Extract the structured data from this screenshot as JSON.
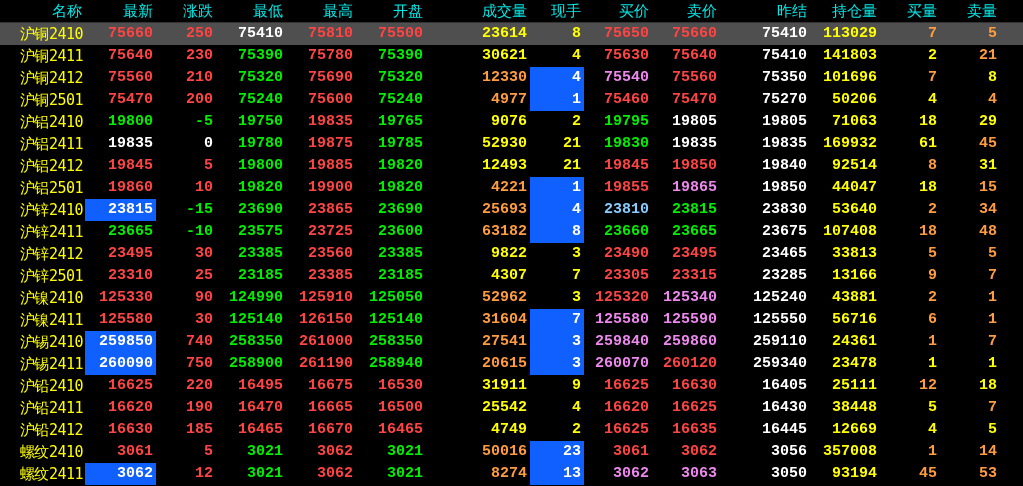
{
  "columns": [
    "名称",
    "最新",
    "涨跌",
    "最低",
    "最高",
    "开盘",
    "成交量",
    "现手",
    "买价",
    "卖价",
    "昨结",
    "持仓量",
    "买量",
    "卖量"
  ],
  "rows": [
    {
      "name": "沪铜2410",
      "selected": true,
      "cells": [
        {
          "text": "75660",
          "color": "#ff4444",
          "flash": false
        },
        {
          "text": "250",
          "color": "#ff4444",
          "flash": false
        },
        {
          "text": "75410",
          "color": "#ffffff",
          "flash": false
        },
        {
          "text": "75810",
          "color": "#ff4444",
          "flash": false
        },
        {
          "text": "75500",
          "color": "#ff4444",
          "flash": false
        },
        {
          "text": "23614",
          "color": "#ffff00",
          "flash": false
        },
        {
          "text": "8",
          "color": "#ffff00",
          "flash": false
        },
        {
          "text": "75650",
          "color": "#ff4444",
          "flash": false
        },
        {
          "text": "75660",
          "color": "#ff4444",
          "flash": false
        },
        {
          "text": "75410",
          "color": "#ffffff",
          "flash": false
        },
        {
          "text": "113029",
          "color": "#ffff00",
          "flash": false
        },
        {
          "text": "7",
          "color": "#ff9c40",
          "flash": false
        },
        {
          "text": "5",
          "color": "#ff9c40",
          "flash": false
        }
      ]
    },
    {
      "name": "沪铜2411",
      "selected": false,
      "cells": [
        {
          "text": "75640",
          "color": "#ff4444",
          "flash": false
        },
        {
          "text": "230",
          "color": "#ff4444",
          "flash": false
        },
        {
          "text": "75390",
          "color": "#00ee00",
          "flash": false
        },
        {
          "text": "75780",
          "color": "#ff4444",
          "flash": false
        },
        {
          "text": "75390",
          "color": "#00ee00",
          "flash": false
        },
        {
          "text": "30621",
          "color": "#ffff00",
          "flash": false
        },
        {
          "text": "4",
          "color": "#ffff00",
          "flash": false
        },
        {
          "text": "75630",
          "color": "#ff4444",
          "flash": false
        },
        {
          "text": "75640",
          "color": "#ff4444",
          "flash": false
        },
        {
          "text": "75410",
          "color": "#ffffff",
          "flash": false
        },
        {
          "text": "141803",
          "color": "#ffff00",
          "flash": false
        },
        {
          "text": "2",
          "color": "#ffff00",
          "flash": false
        },
        {
          "text": "21",
          "color": "#ff9c40",
          "flash": false
        }
      ]
    },
    {
      "name": "沪铜2412",
      "selected": false,
      "cells": [
        {
          "text": "75560",
          "color": "#ff4444",
          "flash": false
        },
        {
          "text": "210",
          "color": "#ff4444",
          "flash": false
        },
        {
          "text": "75320",
          "color": "#00ee00",
          "flash": false
        },
        {
          "text": "75690",
          "color": "#ff4444",
          "flash": false
        },
        {
          "text": "75320",
          "color": "#00ee00",
          "flash": false
        },
        {
          "text": "12330",
          "color": "#ff9c40",
          "flash": false
        },
        {
          "text": "4",
          "color": "#ffffff",
          "flash": true
        },
        {
          "text": "75540",
          "color": "#ee88ee",
          "flash": false
        },
        {
          "text": "75560",
          "color": "#ff4444",
          "flash": false
        },
        {
          "text": "75350",
          "color": "#ffffff",
          "flash": false
        },
        {
          "text": "101696",
          "color": "#ffff00",
          "flash": false
        },
        {
          "text": "7",
          "color": "#ff9c40",
          "flash": false
        },
        {
          "text": "8",
          "color": "#ffff00",
          "flash": false
        }
      ]
    },
    {
      "name": "沪铜2501",
      "selected": false,
      "cells": [
        {
          "text": "75470",
          "color": "#ff4444",
          "flash": false
        },
        {
          "text": "200",
          "color": "#ff4444",
          "flash": false
        },
        {
          "text": "75240",
          "color": "#00ee00",
          "flash": false
        },
        {
          "text": "75600",
          "color": "#ff4444",
          "flash": false
        },
        {
          "text": "75240",
          "color": "#00ee00",
          "flash": false
        },
        {
          "text": "4977",
          "color": "#ff9c40",
          "flash": false
        },
        {
          "text": "1",
          "color": "#ffffff",
          "flash": true
        },
        {
          "text": "75460",
          "color": "#ff4444",
          "flash": false
        },
        {
          "text": "75470",
          "color": "#ff4444",
          "flash": false
        },
        {
          "text": "75270",
          "color": "#ffffff",
          "flash": false
        },
        {
          "text": "50206",
          "color": "#ffff00",
          "flash": false
        },
        {
          "text": "4",
          "color": "#ffff00",
          "flash": false
        },
        {
          "text": "4",
          "color": "#ff9c40",
          "flash": false
        }
      ]
    },
    {
      "name": "沪铝2410",
      "selected": false,
      "cells": [
        {
          "text": "19800",
          "color": "#00ee00",
          "flash": false
        },
        {
          "text": "-5",
          "color": "#00ee00",
          "flash": false
        },
        {
          "text": "19750",
          "color": "#00ee00",
          "flash": false
        },
        {
          "text": "19835",
          "color": "#ff4444",
          "flash": false
        },
        {
          "text": "19765",
          "color": "#00ee00",
          "flash": false
        },
        {
          "text": "9076",
          "color": "#ffff00",
          "flash": false
        },
        {
          "text": "2",
          "color": "#ffff00",
          "flash": false
        },
        {
          "text": "19795",
          "color": "#00ee00",
          "flash": false
        },
        {
          "text": "19805",
          "color": "#ffffff",
          "flash": false
        },
        {
          "text": "19805",
          "color": "#ffffff",
          "flash": false
        },
        {
          "text": "71063",
          "color": "#ffff00",
          "flash": false
        },
        {
          "text": "18",
          "color": "#ffff00",
          "flash": false
        },
        {
          "text": "29",
          "color": "#ffff00",
          "flash": false
        }
      ]
    },
    {
      "name": "沪铝2411",
      "selected": false,
      "cells": [
        {
          "text": "19835",
          "color": "#ffffff",
          "flash": false
        },
        {
          "text": "0",
          "color": "#ffffff",
          "flash": false
        },
        {
          "text": "19780",
          "color": "#00ee00",
          "flash": false
        },
        {
          "text": "19875",
          "color": "#ff4444",
          "flash": false
        },
        {
          "text": "19785",
          "color": "#00ee00",
          "flash": false
        },
        {
          "text": "52930",
          "color": "#ffff00",
          "flash": false
        },
        {
          "text": "21",
          "color": "#ffff00",
          "flash": false
        },
        {
          "text": "19830",
          "color": "#00ee00",
          "flash": false
        },
        {
          "text": "19835",
          "color": "#ffffff",
          "flash": false
        },
        {
          "text": "19835",
          "color": "#ffffff",
          "flash": false
        },
        {
          "text": "169932",
          "color": "#ffff00",
          "flash": false
        },
        {
          "text": "61",
          "color": "#ffff00",
          "flash": false
        },
        {
          "text": "45",
          "color": "#ff9c40",
          "flash": false
        }
      ]
    },
    {
      "name": "沪铝2412",
      "selected": false,
      "cells": [
        {
          "text": "19845",
          "color": "#ff4444",
          "flash": false
        },
        {
          "text": "5",
          "color": "#ff4444",
          "flash": false
        },
        {
          "text": "19800",
          "color": "#00ee00",
          "flash": false
        },
        {
          "text": "19885",
          "color": "#ff4444",
          "flash": false
        },
        {
          "text": "19820",
          "color": "#00ee00",
          "flash": false
        },
        {
          "text": "12493",
          "color": "#ffff00",
          "flash": false
        },
        {
          "text": "21",
          "color": "#ffff00",
          "flash": false
        },
        {
          "text": "19845",
          "color": "#ff4444",
          "flash": false
        },
        {
          "text": "19850",
          "color": "#ff4444",
          "flash": false
        },
        {
          "text": "19840",
          "color": "#ffffff",
          "flash": false
        },
        {
          "text": "92514",
          "color": "#ffff00",
          "flash": false
        },
        {
          "text": "8",
          "color": "#ff9c40",
          "flash": false
        },
        {
          "text": "31",
          "color": "#ffff00",
          "flash": false
        }
      ]
    },
    {
      "name": "沪铝2501",
      "selected": false,
      "cells": [
        {
          "text": "19860",
          "color": "#ff4444",
          "flash": false
        },
        {
          "text": "10",
          "color": "#ff4444",
          "flash": false
        },
        {
          "text": "19820",
          "color": "#00ee00",
          "flash": false
        },
        {
          "text": "19900",
          "color": "#ff4444",
          "flash": false
        },
        {
          "text": "19820",
          "color": "#00ee00",
          "flash": false
        },
        {
          "text": "4221",
          "color": "#ff9c40",
          "flash": false
        },
        {
          "text": "1",
          "color": "#ffffff",
          "flash": true
        },
        {
          "text": "19855",
          "color": "#ff4444",
          "flash": false
        },
        {
          "text": "19865",
          "color": "#ee88ee",
          "flash": false
        },
        {
          "text": "19850",
          "color": "#ffffff",
          "flash": false
        },
        {
          "text": "44047",
          "color": "#ffff00",
          "flash": false
        },
        {
          "text": "18",
          "color": "#ffff00",
          "flash": false
        },
        {
          "text": "15",
          "color": "#ff9c40",
          "flash": false
        }
      ]
    },
    {
      "name": "沪锌2410",
      "selected": false,
      "cells": [
        {
          "text": "23815",
          "color": "#ffffff",
          "flash": true
        },
        {
          "text": "-15",
          "color": "#00ee00",
          "flash": false
        },
        {
          "text": "23690",
          "color": "#00ee00",
          "flash": false
        },
        {
          "text": "23865",
          "color": "#ff4444",
          "flash": false
        },
        {
          "text": "23690",
          "color": "#00ee00",
          "flash": false
        },
        {
          "text": "25693",
          "color": "#ff9c40",
          "flash": false
        },
        {
          "text": "4",
          "color": "#ffffff",
          "flash": true
        },
        {
          "text": "23810",
          "color": "#88ccff",
          "flash": false
        },
        {
          "text": "23815",
          "color": "#00ee00",
          "flash": false
        },
        {
          "text": "23830",
          "color": "#ffffff",
          "flash": false
        },
        {
          "text": "53640",
          "color": "#ffff00",
          "flash": false
        },
        {
          "text": "2",
          "color": "#ff9c40",
          "flash": false
        },
        {
          "text": "34",
          "color": "#ff9c40",
          "flash": false
        }
      ]
    },
    {
      "name": "沪锌2411",
      "selected": false,
      "cells": [
        {
          "text": "23665",
          "color": "#00ee00",
          "flash": false
        },
        {
          "text": "-10",
          "color": "#00ee00",
          "flash": false
        },
        {
          "text": "23575",
          "color": "#00ee00",
          "flash": false
        },
        {
          "text": "23725",
          "color": "#ff4444",
          "flash": false
        },
        {
          "text": "23600",
          "color": "#00ee00",
          "flash": false
        },
        {
          "text": "63182",
          "color": "#ff9c40",
          "flash": false
        },
        {
          "text": "8",
          "color": "#ffffff",
          "flash": true
        },
        {
          "text": "23660",
          "color": "#00ee00",
          "flash": false
        },
        {
          "text": "23665",
          "color": "#00ee00",
          "flash": false
        },
        {
          "text": "23675",
          "color": "#ffffff",
          "flash": false
        },
        {
          "text": "107408",
          "color": "#ffff00",
          "flash": false
        },
        {
          "text": "18",
          "color": "#ff9c40",
          "flash": false
        },
        {
          "text": "48",
          "color": "#ff9c40",
          "flash": false
        }
      ]
    },
    {
      "name": "沪锌2412",
      "selected": false,
      "cells": [
        {
          "text": "23495",
          "color": "#ff4444",
          "flash": false
        },
        {
          "text": "30",
          "color": "#ff4444",
          "flash": false
        },
        {
          "text": "23385",
          "color": "#00ee00",
          "flash": false
        },
        {
          "text": "23560",
          "color": "#ff4444",
          "flash": false
        },
        {
          "text": "23385",
          "color": "#00ee00",
          "flash": false
        },
        {
          "text": "9822",
          "color": "#ffff00",
          "flash": false
        },
        {
          "text": "3",
          "color": "#ffff00",
          "flash": false
        },
        {
          "text": "23490",
          "color": "#ff4444",
          "flash": false
        },
        {
          "text": "23495",
          "color": "#ff4444",
          "flash": false
        },
        {
          "text": "23465",
          "color": "#ffffff",
          "flash": false
        },
        {
          "text": "33813",
          "color": "#ffff00",
          "flash": false
        },
        {
          "text": "5",
          "color": "#ff9c40",
          "flash": false
        },
        {
          "text": "5",
          "color": "#ff9c40",
          "flash": false
        }
      ]
    },
    {
      "name": "沪锌2501",
      "selected": false,
      "cells": [
        {
          "text": "23310",
          "color": "#ff4444",
          "flash": false
        },
        {
          "text": "25",
          "color": "#ff4444",
          "flash": false
        },
        {
          "text": "23185",
          "color": "#00ee00",
          "flash": false
        },
        {
          "text": "23385",
          "color": "#ff4444",
          "flash": false
        },
        {
          "text": "23185",
          "color": "#00ee00",
          "flash": false
        },
        {
          "text": "4307",
          "color": "#ffff00",
          "flash": false
        },
        {
          "text": "7",
          "color": "#ffff00",
          "flash": false
        },
        {
          "text": "23305",
          "color": "#ff4444",
          "flash": false
        },
        {
          "text": "23315",
          "color": "#ff4444",
          "flash": false
        },
        {
          "text": "23285",
          "color": "#ffffff",
          "flash": false
        },
        {
          "text": "13166",
          "color": "#ffff00",
          "flash": false
        },
        {
          "text": "9",
          "color": "#ff9c40",
          "flash": false
        },
        {
          "text": "7",
          "color": "#ff9c40",
          "flash": false
        }
      ]
    },
    {
      "name": "沪镍2410",
      "selected": false,
      "cells": [
        {
          "text": "125330",
          "color": "#ff4444",
          "flash": false
        },
        {
          "text": "90",
          "color": "#ff4444",
          "flash": false
        },
        {
          "text": "124990",
          "color": "#00ee00",
          "flash": false
        },
        {
          "text": "125910",
          "color": "#ff4444",
          "flash": false
        },
        {
          "text": "125050",
          "color": "#00ee00",
          "flash": false
        },
        {
          "text": "52962",
          "color": "#ff9c40",
          "flash": false
        },
        {
          "text": "3",
          "color": "#ffff00",
          "flash": false
        },
        {
          "text": "125320",
          "color": "#ff4444",
          "flash": false
        },
        {
          "text": "125340",
          "color": "#ee88ee",
          "flash": false
        },
        {
          "text": "125240",
          "color": "#ffffff",
          "flash": false
        },
        {
          "text": "43881",
          "color": "#ffff00",
          "flash": false
        },
        {
          "text": "2",
          "color": "#ff9c40",
          "flash": false
        },
        {
          "text": "1",
          "color": "#ff9c40",
          "flash": false
        }
      ]
    },
    {
      "name": "沪镍2411",
      "selected": false,
      "cells": [
        {
          "text": "125580",
          "color": "#ff4444",
          "flash": false
        },
        {
          "text": "30",
          "color": "#ff4444",
          "flash": false
        },
        {
          "text": "125140",
          "color": "#00ee00",
          "flash": false
        },
        {
          "text": "126150",
          "color": "#ff4444",
          "flash": false
        },
        {
          "text": "125140",
          "color": "#00ee00",
          "flash": false
        },
        {
          "text": "31604",
          "color": "#ff9c40",
          "flash": false
        },
        {
          "text": "7",
          "color": "#ffffff",
          "flash": true
        },
        {
          "text": "125580",
          "color": "#ee88ee",
          "flash": false
        },
        {
          "text": "125590",
          "color": "#ee88ee",
          "flash": false
        },
        {
          "text": "125550",
          "color": "#ffffff",
          "flash": false
        },
        {
          "text": "56716",
          "color": "#ffff00",
          "flash": false
        },
        {
          "text": "6",
          "color": "#ff9c40",
          "flash": false
        },
        {
          "text": "1",
          "color": "#ff9c40",
          "flash": false
        }
      ]
    },
    {
      "name": "沪锡2410",
      "selected": false,
      "cells": [
        {
          "text": "259850",
          "color": "#ffffff",
          "flash": true
        },
        {
          "text": "740",
          "color": "#ff4444",
          "flash": false
        },
        {
          "text": "258350",
          "color": "#00ee00",
          "flash": false
        },
        {
          "text": "261000",
          "color": "#ff4444",
          "flash": false
        },
        {
          "text": "258350",
          "color": "#00ee00",
          "flash": false
        },
        {
          "text": "27541",
          "color": "#ff9c40",
          "flash": false
        },
        {
          "text": "3",
          "color": "#ffffff",
          "flash": true
        },
        {
          "text": "259840",
          "color": "#ee88ee",
          "flash": false
        },
        {
          "text": "259860",
          "color": "#ee88ee",
          "flash": false
        },
        {
          "text": "259110",
          "color": "#ffffff",
          "flash": false
        },
        {
          "text": "24361",
          "color": "#ffff00",
          "flash": false
        },
        {
          "text": "1",
          "color": "#ff9c40",
          "flash": false
        },
        {
          "text": "7",
          "color": "#ff9c40",
          "flash": false
        }
      ]
    },
    {
      "name": "沪锡2411",
      "selected": false,
      "cells": [
        {
          "text": "260090",
          "color": "#ffffff",
          "flash": true
        },
        {
          "text": "750",
          "color": "#ff4444",
          "flash": false
        },
        {
          "text": "258900",
          "color": "#00ee00",
          "flash": false
        },
        {
          "text": "261190",
          "color": "#ff4444",
          "flash": false
        },
        {
          "text": "258940",
          "color": "#00ee00",
          "flash": false
        },
        {
          "text": "20615",
          "color": "#ff9c40",
          "flash": false
        },
        {
          "text": "3",
          "color": "#ffffff",
          "flash": true
        },
        {
          "text": "260070",
          "color": "#ee88ee",
          "flash": false
        },
        {
          "text": "260120",
          "color": "#ff4444",
          "flash": false
        },
        {
          "text": "259340",
          "color": "#ffffff",
          "flash": false
        },
        {
          "text": "23478",
          "color": "#ffff00",
          "flash": false
        },
        {
          "text": "1",
          "color": "#ffff00",
          "flash": false
        },
        {
          "text": "1",
          "color": "#ffff00",
          "flash": false
        }
      ]
    },
    {
      "name": "沪铅2410",
      "selected": false,
      "cells": [
        {
          "text": "16625",
          "color": "#ff4444",
          "flash": false
        },
        {
          "text": "220",
          "color": "#ff4444",
          "flash": false
        },
        {
          "text": "16495",
          "color": "#ff4444",
          "flash": false
        },
        {
          "text": "16675",
          "color": "#ff4444",
          "flash": false
        },
        {
          "text": "16530",
          "color": "#ff4444",
          "flash": false
        },
        {
          "text": "31911",
          "color": "#ffff00",
          "flash": false
        },
        {
          "text": "9",
          "color": "#ffff00",
          "flash": false
        },
        {
          "text": "16625",
          "color": "#ff4444",
          "flash": false
        },
        {
          "text": "16630",
          "color": "#ff4444",
          "flash": false
        },
        {
          "text": "16405",
          "color": "#ffffff",
          "flash": false
        },
        {
          "text": "25111",
          "color": "#ffff00",
          "flash": false
        },
        {
          "text": "12",
          "color": "#ff9c40",
          "flash": false
        },
        {
          "text": "18",
          "color": "#ffff00",
          "flash": false
        }
      ]
    },
    {
      "name": "沪铅2411",
      "selected": false,
      "cells": [
        {
          "text": "16620",
          "color": "#ff4444",
          "flash": false
        },
        {
          "text": "190",
          "color": "#ff4444",
          "flash": false
        },
        {
          "text": "16470",
          "color": "#ff4444",
          "flash": false
        },
        {
          "text": "16665",
          "color": "#ff4444",
          "flash": false
        },
        {
          "text": "16500",
          "color": "#ff4444",
          "flash": false
        },
        {
          "text": "25542",
          "color": "#ffff00",
          "flash": false
        },
        {
          "text": "4",
          "color": "#ffff00",
          "flash": false
        },
        {
          "text": "16620",
          "color": "#ff4444",
          "flash": false
        },
        {
          "text": "16625",
          "color": "#ff4444",
          "flash": false
        },
        {
          "text": "16430",
          "color": "#ffffff",
          "flash": false
        },
        {
          "text": "38448",
          "color": "#ffff00",
          "flash": false
        },
        {
          "text": "5",
          "color": "#ffff00",
          "flash": false
        },
        {
          "text": "7",
          "color": "#ff9c40",
          "flash": false
        }
      ]
    },
    {
      "name": "沪铅2412",
      "selected": false,
      "cells": [
        {
          "text": "16630",
          "color": "#ff4444",
          "flash": false
        },
        {
          "text": "185",
          "color": "#ff4444",
          "flash": false
        },
        {
          "text": "16465",
          "color": "#ff4444",
          "flash": false
        },
        {
          "text": "16670",
          "color": "#ff4444",
          "flash": false
        },
        {
          "text": "16465",
          "color": "#ff4444",
          "flash": false
        },
        {
          "text": "4749",
          "color": "#ffff00",
          "flash": false
        },
        {
          "text": "2",
          "color": "#ffff00",
          "flash": false
        },
        {
          "text": "16625",
          "color": "#ff4444",
          "flash": false
        },
        {
          "text": "16635",
          "color": "#ff4444",
          "flash": false
        },
        {
          "text": "16445",
          "color": "#ffffff",
          "flash": false
        },
        {
          "text": "12669",
          "color": "#ffff00",
          "flash": false
        },
        {
          "text": "4",
          "color": "#ffff00",
          "flash": false
        },
        {
          "text": "5",
          "color": "#ffff00",
          "flash": false
        }
      ]
    },
    {
      "name": "螺纹2410",
      "selected": false,
      "cells": [
        {
          "text": "3061",
          "color": "#ff4444",
          "flash": false
        },
        {
          "text": "5",
          "color": "#ff4444",
          "flash": false
        },
        {
          "text": "3021",
          "color": "#00ee00",
          "flash": false
        },
        {
          "text": "3062",
          "color": "#ff4444",
          "flash": false
        },
        {
          "text": "3021",
          "color": "#00ee00",
          "flash": false
        },
        {
          "text": "50016",
          "color": "#ff9c40",
          "flash": false
        },
        {
          "text": "23",
          "color": "#ffffff",
          "flash": true
        },
        {
          "text": "3061",
          "color": "#ff4444",
          "flash": false
        },
        {
          "text": "3062",
          "color": "#ff4444",
          "flash": false
        },
        {
          "text": "3056",
          "color": "#ffffff",
          "flash": false
        },
        {
          "text": "357008",
          "color": "#ffff00",
          "flash": false
        },
        {
          "text": "1",
          "color": "#ff9c40",
          "flash": false
        },
        {
          "text": "14",
          "color": "#ff9c40",
          "flash": false
        }
      ]
    },
    {
      "name": "螺纹2411",
      "selected": false,
      "cells": [
        {
          "text": "3062",
          "color": "#ffffff",
          "flash": true
        },
        {
          "text": "12",
          "color": "#ff4444",
          "flash": false
        },
        {
          "text": "3021",
          "color": "#00ee00",
          "flash": false
        },
        {
          "text": "3062",
          "color": "#ff4444",
          "flash": false
        },
        {
          "text": "3021",
          "color": "#00ee00",
          "flash": false
        },
        {
          "text": "8274",
          "color": "#ff9c40",
          "flash": false
        },
        {
          "text": "13",
          "color": "#ffffff",
          "flash": true
        },
        {
          "text": "3062",
          "color": "#ee88ee",
          "flash": false
        },
        {
          "text": "3063",
          "color": "#ee88ee",
          "flash": false
        },
        {
          "text": "3050",
          "color": "#ffffff",
          "flash": false
        },
        {
          "text": "93194",
          "color": "#ffff00",
          "flash": false
        },
        {
          "text": "45",
          "color": "#ff9c40",
          "flash": false
        },
        {
          "text": "53",
          "color": "#ff9c40",
          "flash": false
        }
      ]
    }
  ]
}
